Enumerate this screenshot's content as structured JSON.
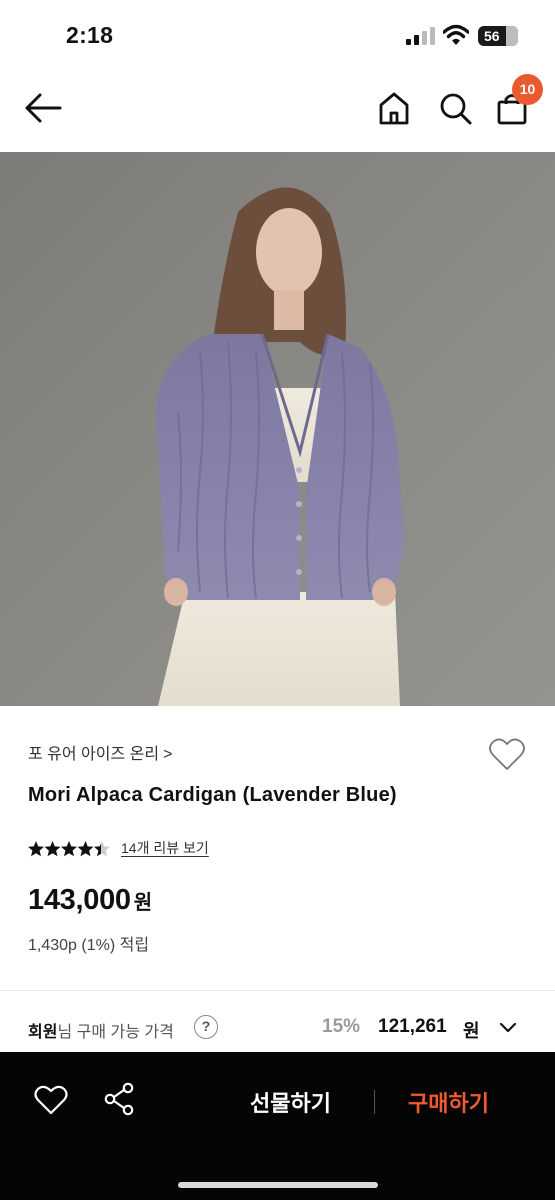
{
  "status_bar": {
    "time": "2:18",
    "battery": "56"
  },
  "nav": {
    "cart_badge": "10"
  },
  "product": {
    "brand": "포 유어 아이즈 온리",
    "brand_chevron": ">",
    "name": "Mori Alpaca Cardigan (Lavender Blue)",
    "rating": 4.5,
    "review_link": "14개 리뷰 보기",
    "price": "143,000",
    "price_unit": "원",
    "points": "1,430p (1%) 적립"
  },
  "member_price": {
    "label_bold": "회원",
    "label_rest": "님 구매 가능 가격",
    "help": "?",
    "discount": "15%",
    "price": "121,261",
    "unit": "원"
  },
  "bottom_bar": {
    "gift_label": "선물하기",
    "buy_label": "구매하기"
  },
  "colors": {
    "accent": "#ea5a30",
    "buy": "#ef5a33",
    "bar": "#050505",
    "cardigan": "#8a84a8"
  }
}
